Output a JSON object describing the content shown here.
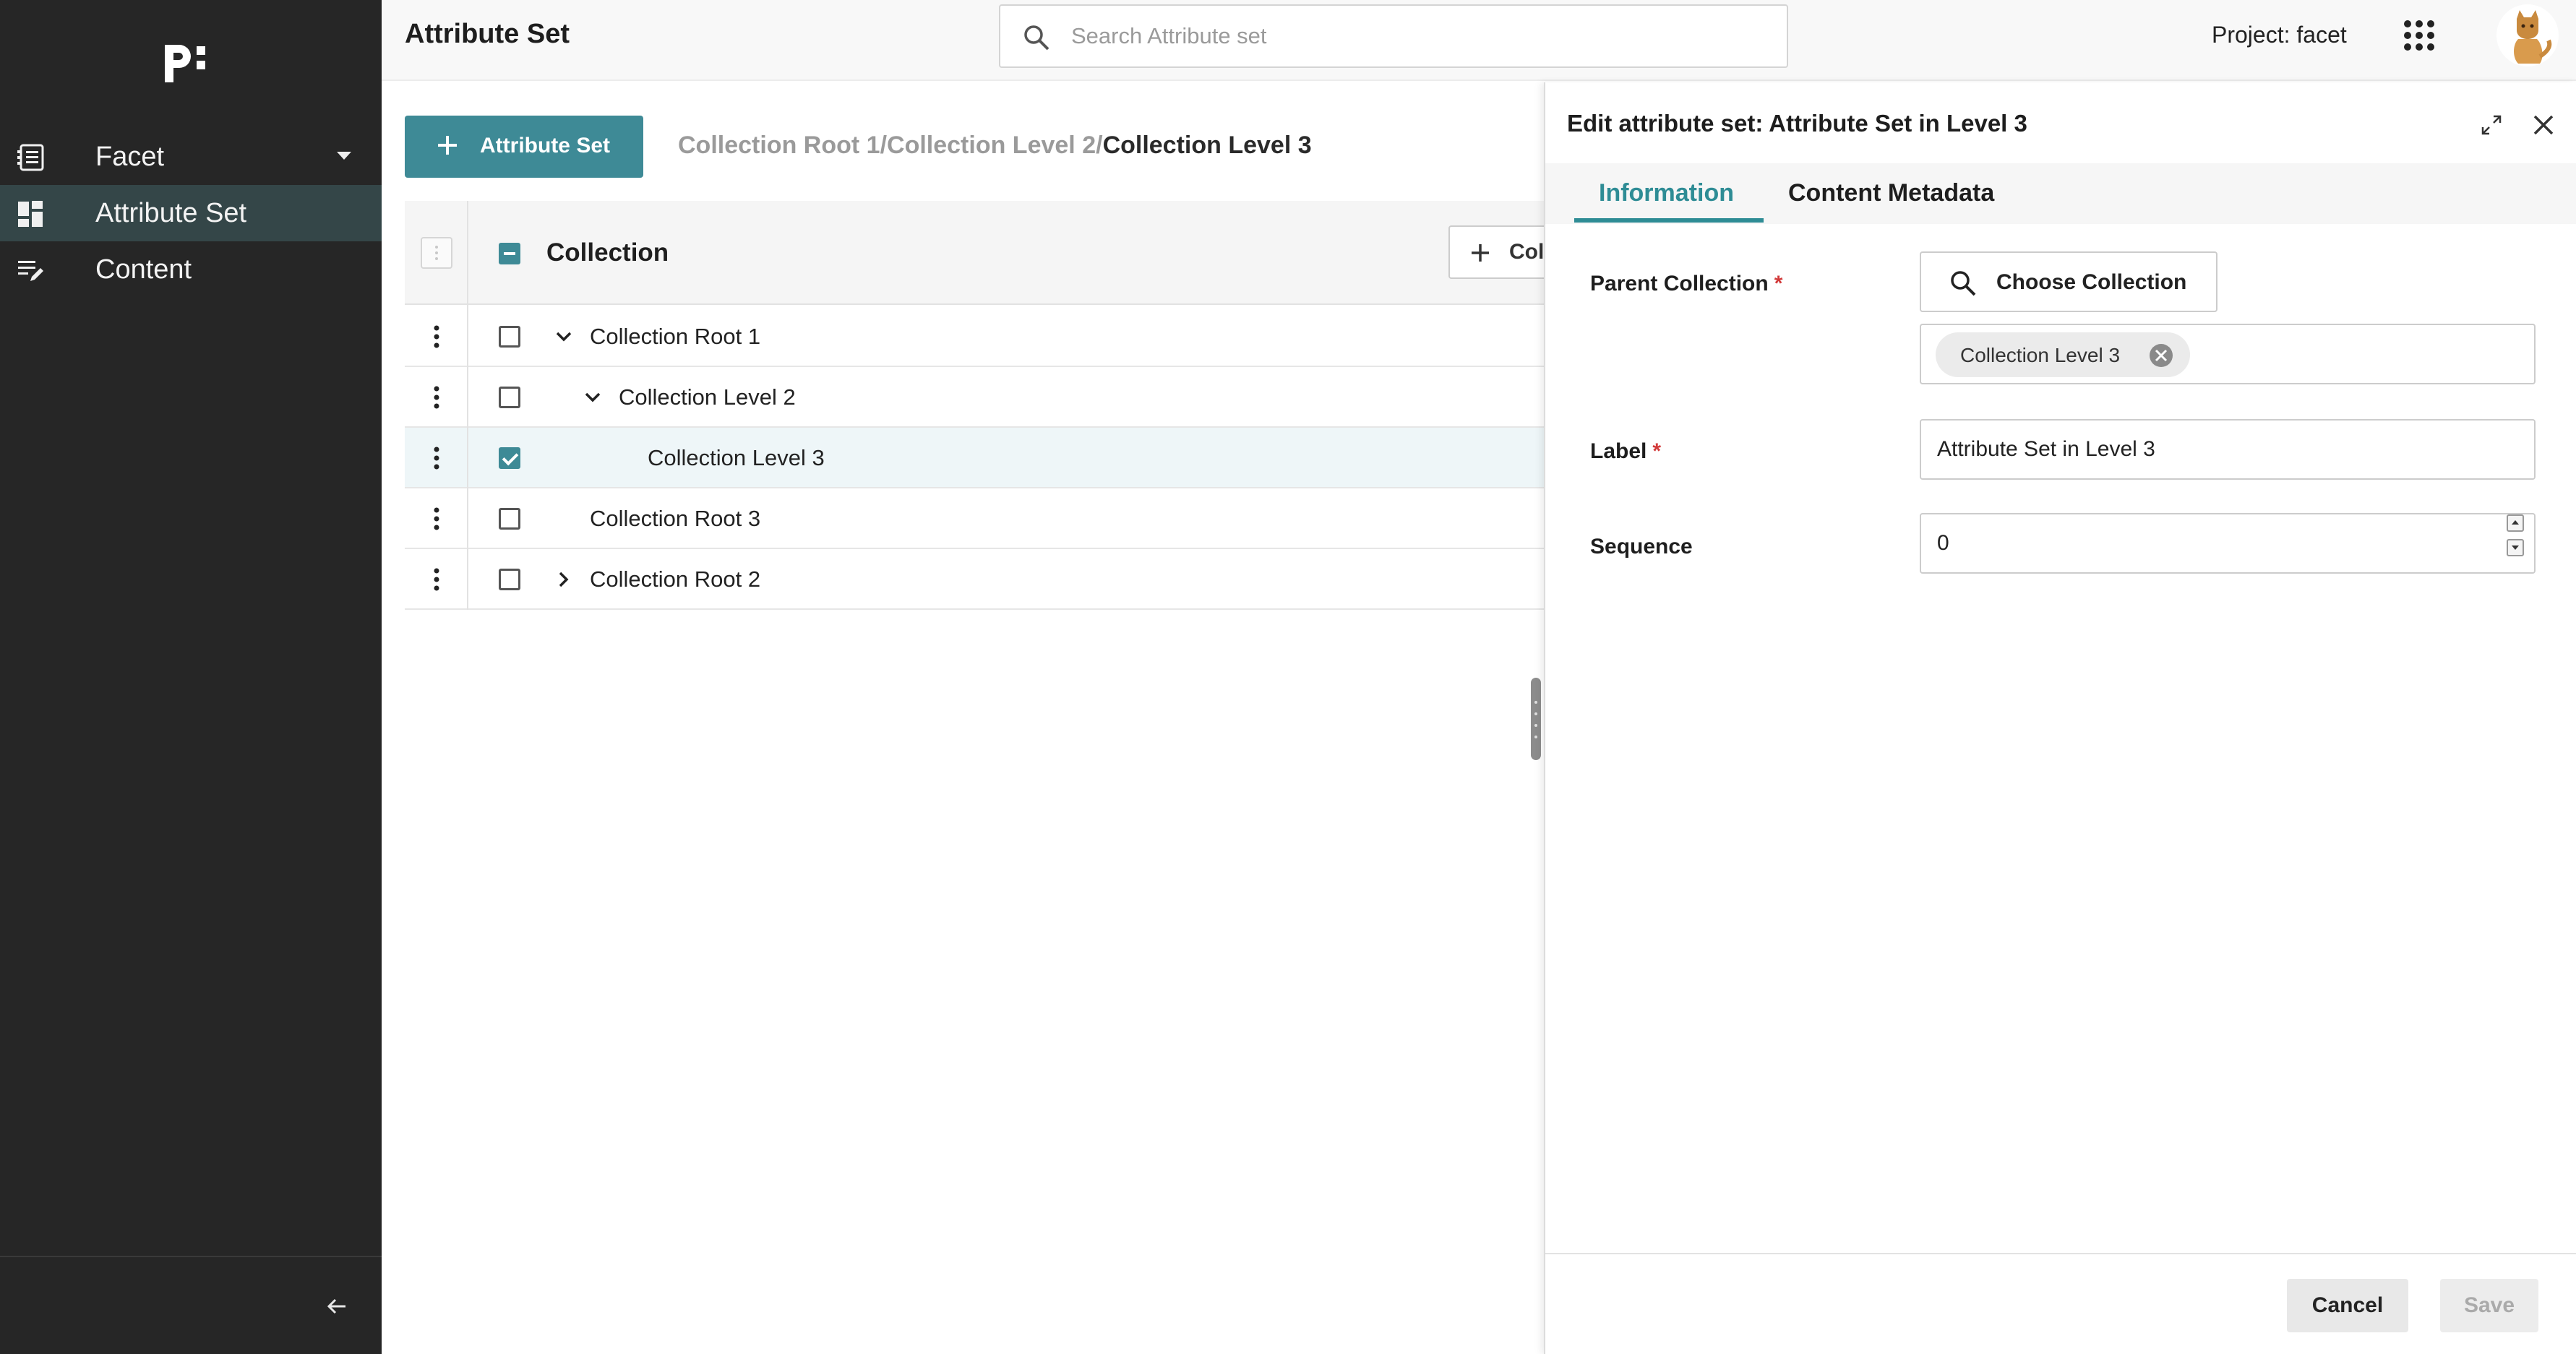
{
  "sidebar": {
    "nav": [
      {
        "label": "Facet"
      },
      {
        "label": "Attribute Set"
      },
      {
        "label": "Content"
      }
    ]
  },
  "header": {
    "title": "Attribute Set",
    "search_placeholder": "Search Attribute set",
    "project_label": "Project: facet"
  },
  "main": {
    "add_button_label": "Attribute Set",
    "breadcrumb": [
      "Collection Root 1",
      "Collection Level 2",
      "Collection Level 3"
    ],
    "breadcrumb_separator": "/",
    "table": {
      "column_title": "Collection",
      "add_column_button": "Col",
      "rows": [
        {
          "label": "Collection Root 1",
          "checked": false,
          "toggle": "expanded",
          "level": 0
        },
        {
          "label": "Collection Level 2",
          "checked": false,
          "toggle": "expanded",
          "level": 1
        },
        {
          "label": "Collection Level 3",
          "checked": true,
          "toggle": "none",
          "level": 2
        },
        {
          "label": "Collection Root 3",
          "checked": false,
          "toggle": "none",
          "level": 0
        },
        {
          "label": "Collection Root 2",
          "checked": false,
          "toggle": "collapsed",
          "level": 0
        }
      ]
    }
  },
  "drawer": {
    "title": "Edit attribute set: Attribute Set in Level 3",
    "tabs": [
      {
        "label": "Information",
        "active": true
      },
      {
        "label": "Content Metadata",
        "active": false
      }
    ],
    "fields": {
      "parent_collection": {
        "label": "Parent Collection",
        "required": "*",
        "choose_button": "Choose Collection",
        "chip": "Collection Level 3"
      },
      "label": {
        "label": "Label",
        "required": "*",
        "value": "Attribute Set in Level 3"
      },
      "sequence": {
        "label": "Sequence",
        "value": "0"
      }
    },
    "footer": {
      "cancel": "Cancel",
      "save": "Save"
    }
  },
  "colors": {
    "sidebar_bg": "#262626",
    "sidebar_active": "#344648",
    "accent": "#3e8a96",
    "tab_active": "#2e8c95",
    "required": "#d23a3a"
  }
}
